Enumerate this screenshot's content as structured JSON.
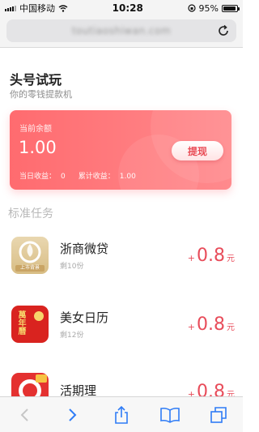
{
  "status_bar": {
    "carrier": "中国移动",
    "time": "10:28",
    "battery": "95%"
  },
  "address_bar": {
    "url": "toutiaoshiwan.com"
  },
  "header": {
    "title": "头号试玩",
    "subtitle": "你的零钱提款机"
  },
  "balance": {
    "label": "当前余额",
    "value": "1.00",
    "withdraw_label": "提现",
    "today_label": "当日收益：",
    "today_value": "0",
    "total_label": "累计收益：",
    "total_value": "1.00"
  },
  "section_title": "标准任务",
  "tasks": [
    {
      "name": "浙商微贷",
      "remaining": "剩10份",
      "plus": "+",
      "amount": "0.8",
      "unit": "元",
      "icon": "zheshang-app-icon",
      "icon_text": "上市背景"
    },
    {
      "name": "美女日历",
      "remaining": "剩12份",
      "plus": "+",
      "amount": "0.8",
      "unit": "元",
      "icon": "calendar-app-icon",
      "icon_text": "萬年曆"
    },
    {
      "name": "活期理",
      "remaining": "",
      "plus": "+",
      "amount": "0.8",
      "unit": "元",
      "icon": "huoqili-app-icon",
      "icon_text": ""
    }
  ],
  "colors": {
    "accent": "#e84c5a",
    "card_start": "#ff6b6f",
    "card_end": "#ff8a8d",
    "toolbar_icon": "#2f7cf6"
  }
}
